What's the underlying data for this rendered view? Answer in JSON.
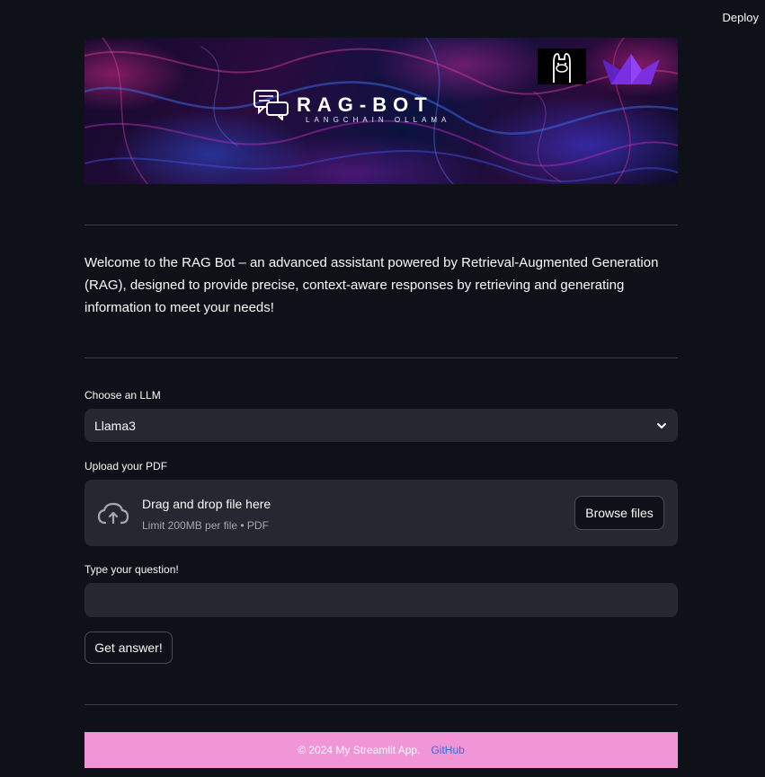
{
  "header": {
    "deploy_label": "Deploy"
  },
  "banner": {
    "title": "RAG-BOT",
    "subtitle": "LANGCHAIN OLLAMA",
    "icons": [
      "chat-bubbles-icon",
      "llama-icon",
      "boat-icon"
    ]
  },
  "intro": {
    "text": "Welcome to the RAG Bot – an advanced assistant powered by Retrieval-Augmented Generation (RAG), designed to provide precise, context-aware responses by retrieving and generating information to meet your needs!"
  },
  "llm_select": {
    "label": "Choose an LLM",
    "value": "Llama3",
    "icon": "chevron-down-icon"
  },
  "upload": {
    "label": "Upload your PDF",
    "drop_title": "Drag and drop file here",
    "limit": "Limit 200MB per file • PDF",
    "browse_label": "Browse files",
    "icon": "cloud-upload-icon"
  },
  "question": {
    "label": "Type your question!",
    "value": "",
    "placeholder": ""
  },
  "submit": {
    "label": "Get answer!"
  },
  "footer": {
    "copyright": "© 2024 My Streamlit App.",
    "link_label": "GitHub"
  },
  "colors": {
    "background": "#0e1117",
    "input_bg": "#262730",
    "footer_bg": "#f195d7",
    "link": "#2f6fe0"
  }
}
